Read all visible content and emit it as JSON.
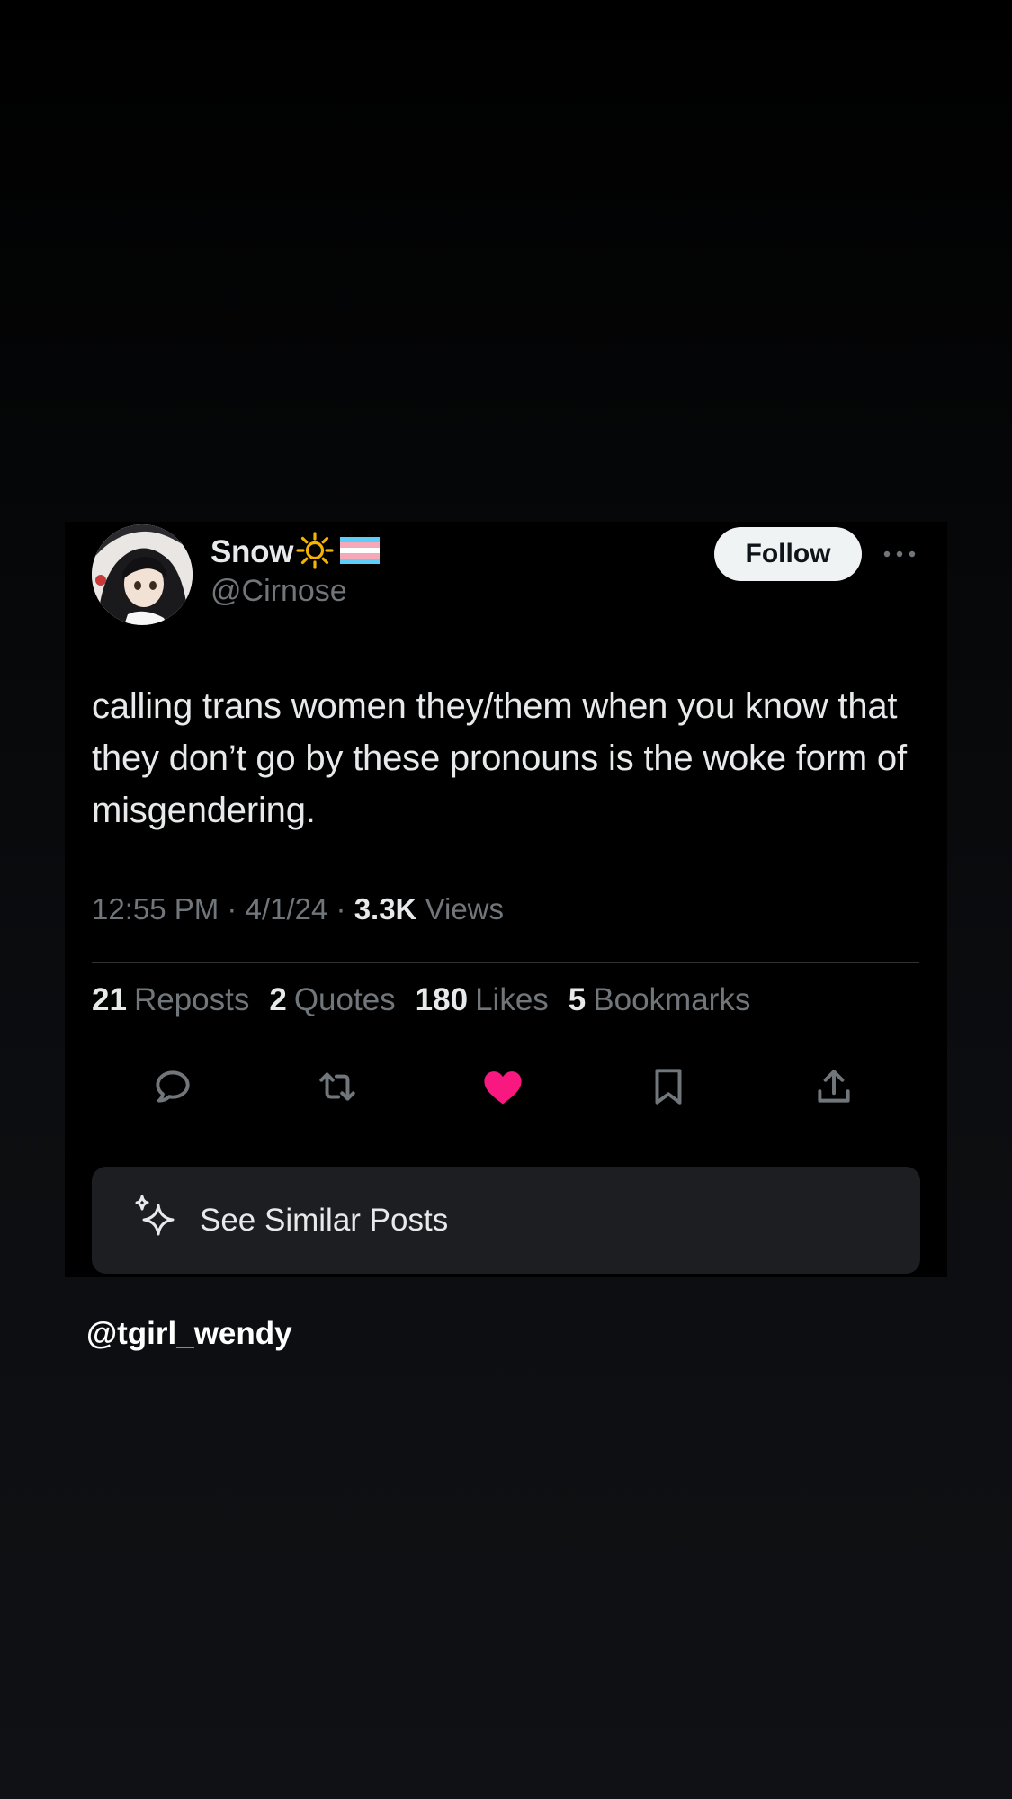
{
  "author": {
    "display_name": "Snow",
    "handle": "@Cirnose",
    "name_emojis": [
      "sun-emoji",
      "transgender-flag-emoji"
    ]
  },
  "follow_label": "Follow",
  "tweet": {
    "text": "calling trans women they/them when you know that they don’t go by these pronouns is the woke form of misgendering.",
    "time": "12:55 PM",
    "date": "4/1/24",
    "views_count": "3.3K",
    "views_label": "Views"
  },
  "stats": {
    "reposts": {
      "count": "21",
      "label": "Reposts"
    },
    "quotes": {
      "count": "2",
      "label": "Quotes"
    },
    "likes": {
      "count": "180",
      "label": "Likes"
    },
    "bookmarks": {
      "count": "5",
      "label": "Bookmarks"
    }
  },
  "actions": [
    "reply-icon",
    "repost-icon",
    "like-icon",
    "bookmark-icon",
    "share-icon"
  ],
  "similar_posts_label": "See Similar Posts",
  "watermark": "@tgirl_wendy",
  "colors": {
    "like": "#f91880",
    "text": "#e7e9ea",
    "muted": "#71767b",
    "follow_bg": "#eff3f4",
    "divider": "#2f3336",
    "panel": "#1c1e22"
  }
}
